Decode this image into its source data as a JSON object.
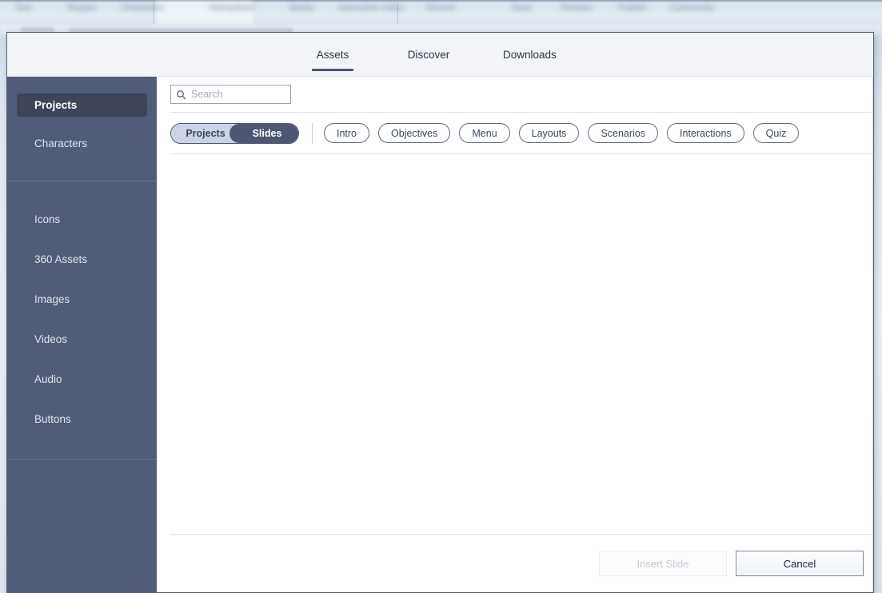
{
  "background_ribbon": {
    "items": [
      "Text",
      "Shapes",
      "Characters",
      "Interactions",
      "Media",
      "Interactive Video",
      "Record",
      "Save",
      "Preview",
      "Publish",
      "Community"
    ]
  },
  "header": {
    "tabs": [
      {
        "label": "Assets",
        "active": true
      },
      {
        "label": "Discover",
        "active": false
      },
      {
        "label": "Downloads",
        "active": false
      }
    ]
  },
  "sidebar": {
    "group_primary": [
      {
        "label": "Projects",
        "active": true
      },
      {
        "label": "Characters",
        "active": false
      }
    ],
    "group_secondary": [
      {
        "label": "Icons",
        "active": false
      },
      {
        "label": "360 Assets",
        "active": false
      },
      {
        "label": "Images",
        "active": false
      },
      {
        "label": "Videos",
        "active": false
      },
      {
        "label": "Audio",
        "active": false
      },
      {
        "label": "Buttons",
        "active": false
      }
    ]
  },
  "search": {
    "placeholder": "Search",
    "value": "",
    "icon": "search-icon"
  },
  "filters": {
    "segmented": [
      {
        "label": "Projects",
        "active": false
      },
      {
        "label": "Slides",
        "active": true
      }
    ],
    "pills": [
      "Intro",
      "Objectives",
      "Menu",
      "Layouts",
      "Scenarios",
      "Interactions",
      "Quiz"
    ]
  },
  "results": {
    "items": [],
    "empty_message": ""
  },
  "footer": {
    "insert_label": "Insert Slide",
    "insert_disabled": true,
    "cancel_label": "Cancel"
  },
  "colors": {
    "sidebar_bg": "#515c77",
    "sidebar_active": "#3e4558",
    "accent": "#4a5370",
    "segment_active": "#4e5672",
    "segment_inactive": "#ccd3e4",
    "pill_border": "#5c6a8a",
    "header_bg": "#f2f4f8",
    "modal_border": "#555f73"
  }
}
